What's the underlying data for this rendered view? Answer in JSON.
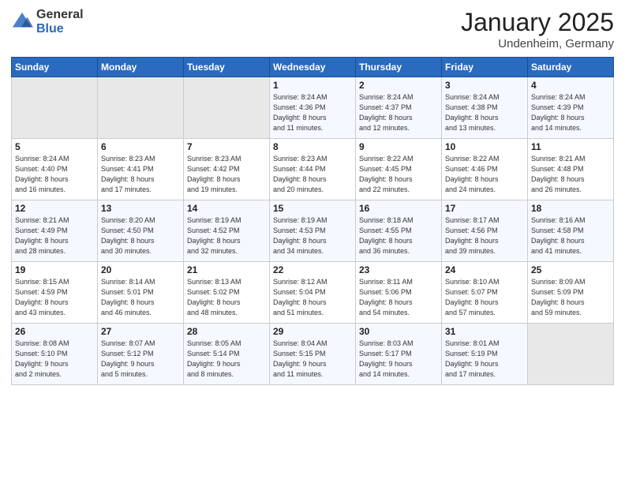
{
  "logo": {
    "general": "General",
    "blue": "Blue"
  },
  "header": {
    "title": "January 2025",
    "location": "Undenheim, Germany"
  },
  "days_of_week": [
    "Sunday",
    "Monday",
    "Tuesday",
    "Wednesday",
    "Thursday",
    "Friday",
    "Saturday"
  ],
  "weeks": [
    [
      {
        "day": "",
        "info": ""
      },
      {
        "day": "",
        "info": ""
      },
      {
        "day": "",
        "info": ""
      },
      {
        "day": "1",
        "info": "Sunrise: 8:24 AM\nSunset: 4:36 PM\nDaylight: 8 hours\nand 11 minutes."
      },
      {
        "day": "2",
        "info": "Sunrise: 8:24 AM\nSunset: 4:37 PM\nDaylight: 8 hours\nand 12 minutes."
      },
      {
        "day": "3",
        "info": "Sunrise: 8:24 AM\nSunset: 4:38 PM\nDaylight: 8 hours\nand 13 minutes."
      },
      {
        "day": "4",
        "info": "Sunrise: 8:24 AM\nSunset: 4:39 PM\nDaylight: 8 hours\nand 14 minutes."
      }
    ],
    [
      {
        "day": "5",
        "info": "Sunrise: 8:24 AM\nSunset: 4:40 PM\nDaylight: 8 hours\nand 16 minutes."
      },
      {
        "day": "6",
        "info": "Sunrise: 8:23 AM\nSunset: 4:41 PM\nDaylight: 8 hours\nand 17 minutes."
      },
      {
        "day": "7",
        "info": "Sunrise: 8:23 AM\nSunset: 4:42 PM\nDaylight: 8 hours\nand 19 minutes."
      },
      {
        "day": "8",
        "info": "Sunrise: 8:23 AM\nSunset: 4:44 PM\nDaylight: 8 hours\nand 20 minutes."
      },
      {
        "day": "9",
        "info": "Sunrise: 8:22 AM\nSunset: 4:45 PM\nDaylight: 8 hours\nand 22 minutes."
      },
      {
        "day": "10",
        "info": "Sunrise: 8:22 AM\nSunset: 4:46 PM\nDaylight: 8 hours\nand 24 minutes."
      },
      {
        "day": "11",
        "info": "Sunrise: 8:21 AM\nSunset: 4:48 PM\nDaylight: 8 hours\nand 26 minutes."
      }
    ],
    [
      {
        "day": "12",
        "info": "Sunrise: 8:21 AM\nSunset: 4:49 PM\nDaylight: 8 hours\nand 28 minutes."
      },
      {
        "day": "13",
        "info": "Sunrise: 8:20 AM\nSunset: 4:50 PM\nDaylight: 8 hours\nand 30 minutes."
      },
      {
        "day": "14",
        "info": "Sunrise: 8:19 AM\nSunset: 4:52 PM\nDaylight: 8 hours\nand 32 minutes."
      },
      {
        "day": "15",
        "info": "Sunrise: 8:19 AM\nSunset: 4:53 PM\nDaylight: 8 hours\nand 34 minutes."
      },
      {
        "day": "16",
        "info": "Sunrise: 8:18 AM\nSunset: 4:55 PM\nDaylight: 8 hours\nand 36 minutes."
      },
      {
        "day": "17",
        "info": "Sunrise: 8:17 AM\nSunset: 4:56 PM\nDaylight: 8 hours\nand 39 minutes."
      },
      {
        "day": "18",
        "info": "Sunrise: 8:16 AM\nSunset: 4:58 PM\nDaylight: 8 hours\nand 41 minutes."
      }
    ],
    [
      {
        "day": "19",
        "info": "Sunrise: 8:15 AM\nSunset: 4:59 PM\nDaylight: 8 hours\nand 43 minutes."
      },
      {
        "day": "20",
        "info": "Sunrise: 8:14 AM\nSunset: 5:01 PM\nDaylight: 8 hours\nand 46 minutes."
      },
      {
        "day": "21",
        "info": "Sunrise: 8:13 AM\nSunset: 5:02 PM\nDaylight: 8 hours\nand 48 minutes."
      },
      {
        "day": "22",
        "info": "Sunrise: 8:12 AM\nSunset: 5:04 PM\nDaylight: 8 hours\nand 51 minutes."
      },
      {
        "day": "23",
        "info": "Sunrise: 8:11 AM\nSunset: 5:06 PM\nDaylight: 8 hours\nand 54 minutes."
      },
      {
        "day": "24",
        "info": "Sunrise: 8:10 AM\nSunset: 5:07 PM\nDaylight: 8 hours\nand 57 minutes."
      },
      {
        "day": "25",
        "info": "Sunrise: 8:09 AM\nSunset: 5:09 PM\nDaylight: 8 hours\nand 59 minutes."
      }
    ],
    [
      {
        "day": "26",
        "info": "Sunrise: 8:08 AM\nSunset: 5:10 PM\nDaylight: 9 hours\nand 2 minutes."
      },
      {
        "day": "27",
        "info": "Sunrise: 8:07 AM\nSunset: 5:12 PM\nDaylight: 9 hours\nand 5 minutes."
      },
      {
        "day": "28",
        "info": "Sunrise: 8:05 AM\nSunset: 5:14 PM\nDaylight: 9 hours\nand 8 minutes."
      },
      {
        "day": "29",
        "info": "Sunrise: 8:04 AM\nSunset: 5:15 PM\nDaylight: 9 hours\nand 11 minutes."
      },
      {
        "day": "30",
        "info": "Sunrise: 8:03 AM\nSunset: 5:17 PM\nDaylight: 9 hours\nand 14 minutes."
      },
      {
        "day": "31",
        "info": "Sunrise: 8:01 AM\nSunset: 5:19 PM\nDaylight: 9 hours\nand 17 minutes."
      },
      {
        "day": "",
        "info": ""
      }
    ]
  ]
}
